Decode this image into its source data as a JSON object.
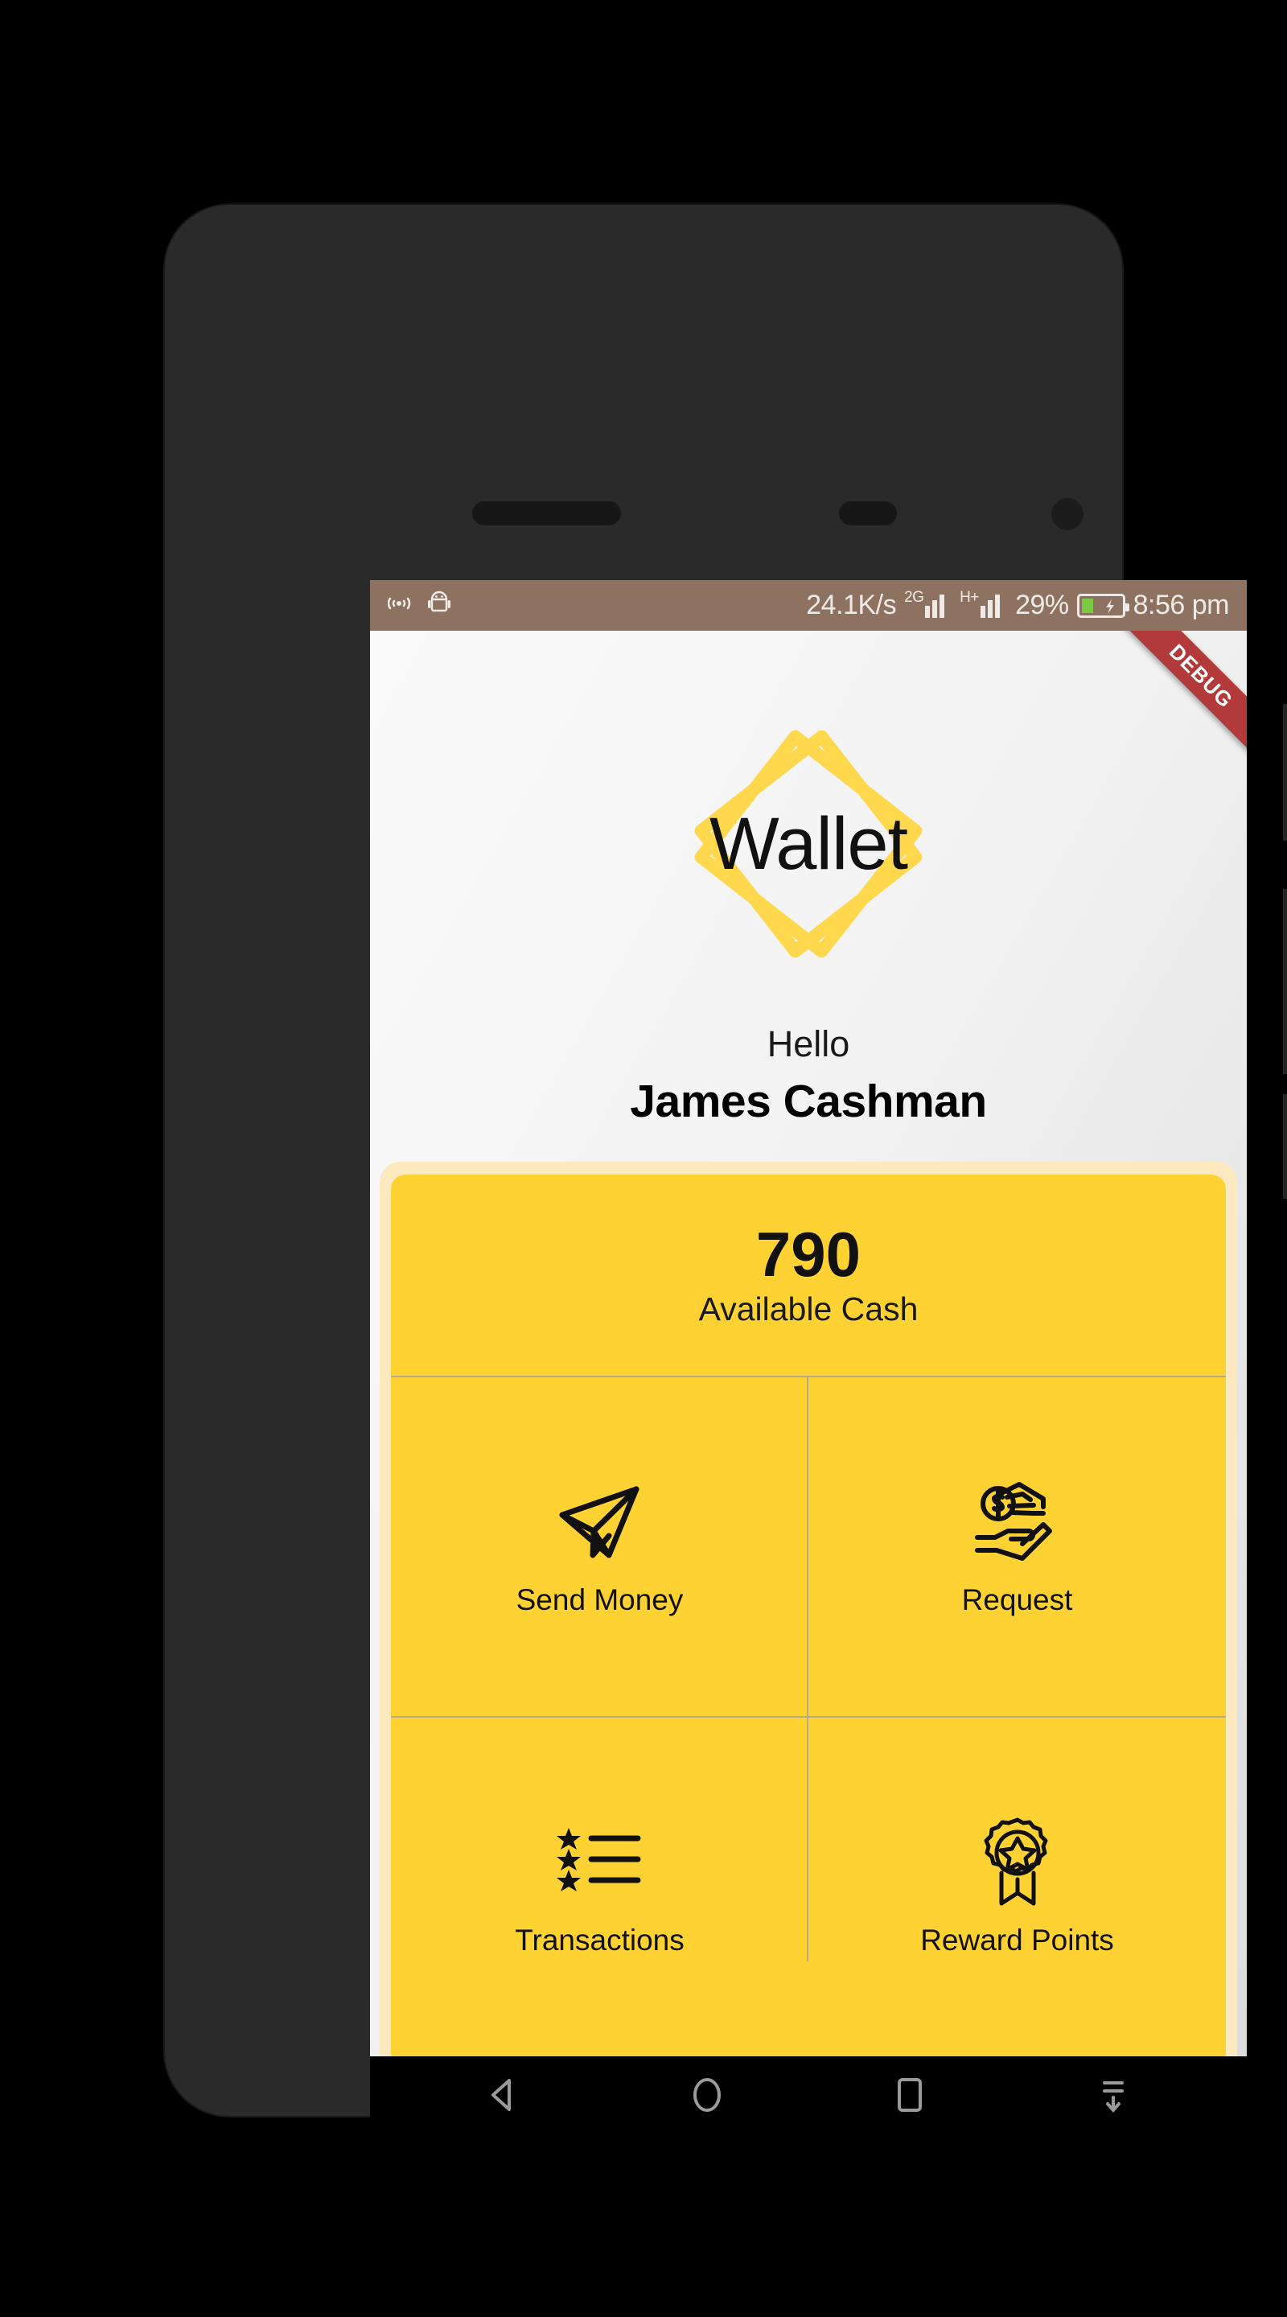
{
  "status_bar": {
    "icons_left": [
      "cast-icon",
      "android-robot-icon"
    ],
    "network_speed": "24.1K/s",
    "network_type_1": "2G",
    "network_type_2": "H+",
    "battery_percent": "29%",
    "battery_level": 29,
    "time": "8:56 pm",
    "background_color": "#8d7261"
  },
  "debug_banner": {
    "label": "DEBUG",
    "color": "#b33a3a"
  },
  "header": {
    "logo_text": "Wallet",
    "logo_color": "#ffd84d",
    "greeting": "Hello",
    "user_name": "James Cashman"
  },
  "card": {
    "background_color": "#ffd233",
    "border_color": "#fce9bf",
    "balance_amount": "790",
    "balance_label": "Available Cash",
    "actions": [
      {
        "label": "Send Money",
        "icon": "paper-plane-icon"
      },
      {
        "label": "Request",
        "icon": "hands-money-icon"
      },
      {
        "label": "Transactions",
        "icon": "star-list-icon"
      },
      {
        "label": "Reward Points",
        "icon": "award-medal-icon"
      }
    ]
  },
  "nav_bar": {
    "buttons": [
      {
        "name": "back",
        "icon": "triangle-left-icon"
      },
      {
        "name": "home",
        "icon": "circle-icon"
      },
      {
        "name": "recents",
        "icon": "square-icon"
      },
      {
        "name": "hide",
        "icon": "collapse-down-icon"
      }
    ]
  }
}
